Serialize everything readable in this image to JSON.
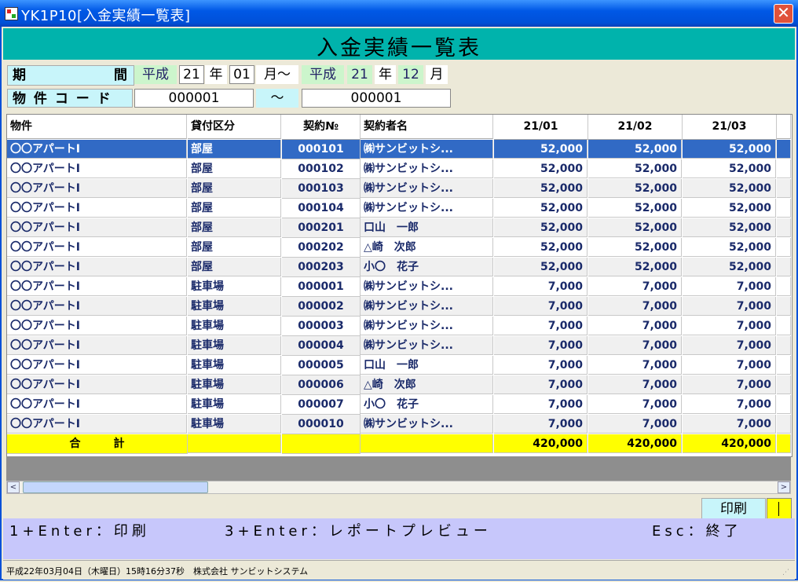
{
  "window": {
    "title": "YK1P10[入金実績一覧表]",
    "close_glyph": "✕"
  },
  "header": {
    "title": "入金実績一覧表"
  },
  "filters": {
    "period_label_1": "期",
    "period_label_2": "間",
    "from_era": "平成",
    "from_year": "21",
    "year_char": "年",
    "from_month": "01",
    "month_tilde": "月～",
    "to_era": "平成",
    "to_year": "21",
    "to_year_char": "年",
    "to_month": "12",
    "to_month_char": "月",
    "property_code_label": "物 件 コ ー ド",
    "code_from": "000001",
    "code_tilde": "～",
    "code_to": "000001"
  },
  "table": {
    "columns": [
      "物件",
      "貸付区分",
      "契約№",
      "契約者名",
      "21/01",
      "21/02",
      "21/03"
    ],
    "rows": [
      [
        "〇〇アパートⅠ",
        "部屋",
        "000101",
        "㈱サンビットシ...",
        "52,000",
        "52,000",
        "52,000"
      ],
      [
        "〇〇アパートⅠ",
        "部屋",
        "000102",
        "㈱サンビットシ...",
        "52,000",
        "52,000",
        "52,000"
      ],
      [
        "〇〇アパートⅠ",
        "部屋",
        "000103",
        "㈱サンビットシ...",
        "52,000",
        "52,000",
        "52,000"
      ],
      [
        "〇〇アパートⅠ",
        "部屋",
        "000104",
        "㈱サンビットシ...",
        "52,000",
        "52,000",
        "52,000"
      ],
      [
        "〇〇アパートⅠ",
        "部屋",
        "000201",
        "口山　一郎",
        "52,000",
        "52,000",
        "52,000"
      ],
      [
        "〇〇アパートⅠ",
        "部屋",
        "000202",
        "△崎　次郎",
        "52,000",
        "52,000",
        "52,000"
      ],
      [
        "〇〇アパートⅠ",
        "部屋",
        "000203",
        "小〇　花子",
        "52,000",
        "52,000",
        "52,000"
      ],
      [
        "〇〇アパートⅠ",
        "駐車場",
        "000001",
        "㈱サンビットシ...",
        "7,000",
        "7,000",
        "7,000"
      ],
      [
        "〇〇アパートⅠ",
        "駐車場",
        "000002",
        "㈱サンビットシ...",
        "7,000",
        "7,000",
        "7,000"
      ],
      [
        "〇〇アパートⅠ",
        "駐車場",
        "000003",
        "㈱サンビットシ...",
        "7,000",
        "7,000",
        "7,000"
      ],
      [
        "〇〇アパートⅠ",
        "駐車場",
        "000004",
        "㈱サンビットシ...",
        "7,000",
        "7,000",
        "7,000"
      ],
      [
        "〇〇アパートⅠ",
        "駐車場",
        "000005",
        "口山　一郎",
        "7,000",
        "7,000",
        "7,000"
      ],
      [
        "〇〇アパートⅠ",
        "駐車場",
        "000006",
        "△崎　次郎",
        "7,000",
        "7,000",
        "7,000"
      ],
      [
        "〇〇アパートⅠ",
        "駐車場",
        "000007",
        "小〇　花子",
        "7,000",
        "7,000",
        "7,000"
      ],
      [
        "〇〇アパートⅠ",
        "駐車場",
        "000010",
        "㈱サンビットシ...",
        "7,000",
        "7,000",
        "7,000"
      ]
    ],
    "total_label": "合　　　計",
    "totals": [
      "420,000",
      "420,000",
      "420,000"
    ]
  },
  "scrollbar": {
    "left_arrow": "<",
    "right_arrow": ">"
  },
  "print": {
    "label": "印刷"
  },
  "function_keys": {
    "print": "1+Enter：印刷",
    "preview": "3+Enter：レポートプレビュー",
    "exit": "Esc：終了"
  },
  "status": {
    "text": "平成22年03月04日（木曜日）15時16分37秒　株式会社 サンビットシステム"
  },
  "colors": {
    "banner": "#00B3AC",
    "selected_row": "#316AC5",
    "total_row": "#FFFF00",
    "function_bar": "#C7C7FB"
  }
}
